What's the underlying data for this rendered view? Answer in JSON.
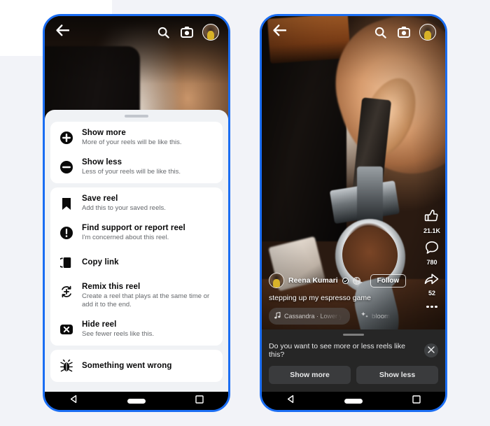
{
  "theme": {
    "page_background": "#f2f3f8",
    "phone_border": "#1b6ef3",
    "sheet_background": "#f0f2f5",
    "card_background": "#ffffff",
    "title_color": "#080809",
    "subtitle_color": "#65686c",
    "prompt_background": "#262626"
  },
  "topbar": {
    "back_icon": "arrow-left-icon",
    "search_icon": "search-icon",
    "camera_icon": "camera-icon",
    "avatar": "profile-avatar"
  },
  "left_phone": {
    "menu": {
      "groups": [
        {
          "items": [
            {
              "icon": "plus-circle-icon",
              "title": "Show more",
              "subtitle": "More of your reels will be like this."
            },
            {
              "icon": "minus-circle-icon",
              "title": "Show less",
              "subtitle": "Less of your reels will be like this."
            }
          ]
        },
        {
          "items": [
            {
              "icon": "bookmark-icon",
              "title": "Save reel",
              "subtitle": "Add this to your saved reels."
            },
            {
              "icon": "exclamation-circle-icon",
              "title": "Find support or report reel",
              "subtitle": "I'm concerned about this reel."
            },
            {
              "icon": "copy-link-icon",
              "title": "Copy link",
              "subtitle": ""
            },
            {
              "icon": "remix-icon",
              "title": "Remix this reel",
              "subtitle": "Create a reel that plays at the same time or add it to the end."
            },
            {
              "icon": "hide-x-icon",
              "title": "Hide reel",
              "subtitle": "See fewer reels like this."
            }
          ]
        },
        {
          "items": [
            {
              "icon": "bug-icon",
              "title": "Something went wrong",
              "subtitle": ""
            }
          ]
        }
      ]
    }
  },
  "right_phone": {
    "rail": [
      {
        "icon": "thumbs-up-icon",
        "count": "21.1K"
      },
      {
        "icon": "comment-icon",
        "count": "780"
      },
      {
        "icon": "share-icon",
        "count": "52"
      },
      {
        "icon": "more-options-icon",
        "count": ""
      }
    ],
    "post": {
      "author": "Reena Kumari",
      "verified_badge": "verified-check-icon",
      "audience_badge": "globe-icon",
      "follow_label": "Follow",
      "caption": "stepping up my espresso game",
      "music_icon": "music-note-icon",
      "music_label": "Cassandra · Lower y",
      "ai_icon": "ai-sparkle-icon",
      "ai_label": "bloom"
    },
    "prompt": {
      "question": "Do you want to see more or less reels like this?",
      "close_icon": "close-icon",
      "show_more_label": "Show more",
      "show_less_label": "Show less"
    }
  },
  "navbar": {
    "back_icon": "nav-back-triangle-icon",
    "home_icon": "nav-home-pill-icon",
    "recents_icon": "nav-recents-square-icon"
  }
}
